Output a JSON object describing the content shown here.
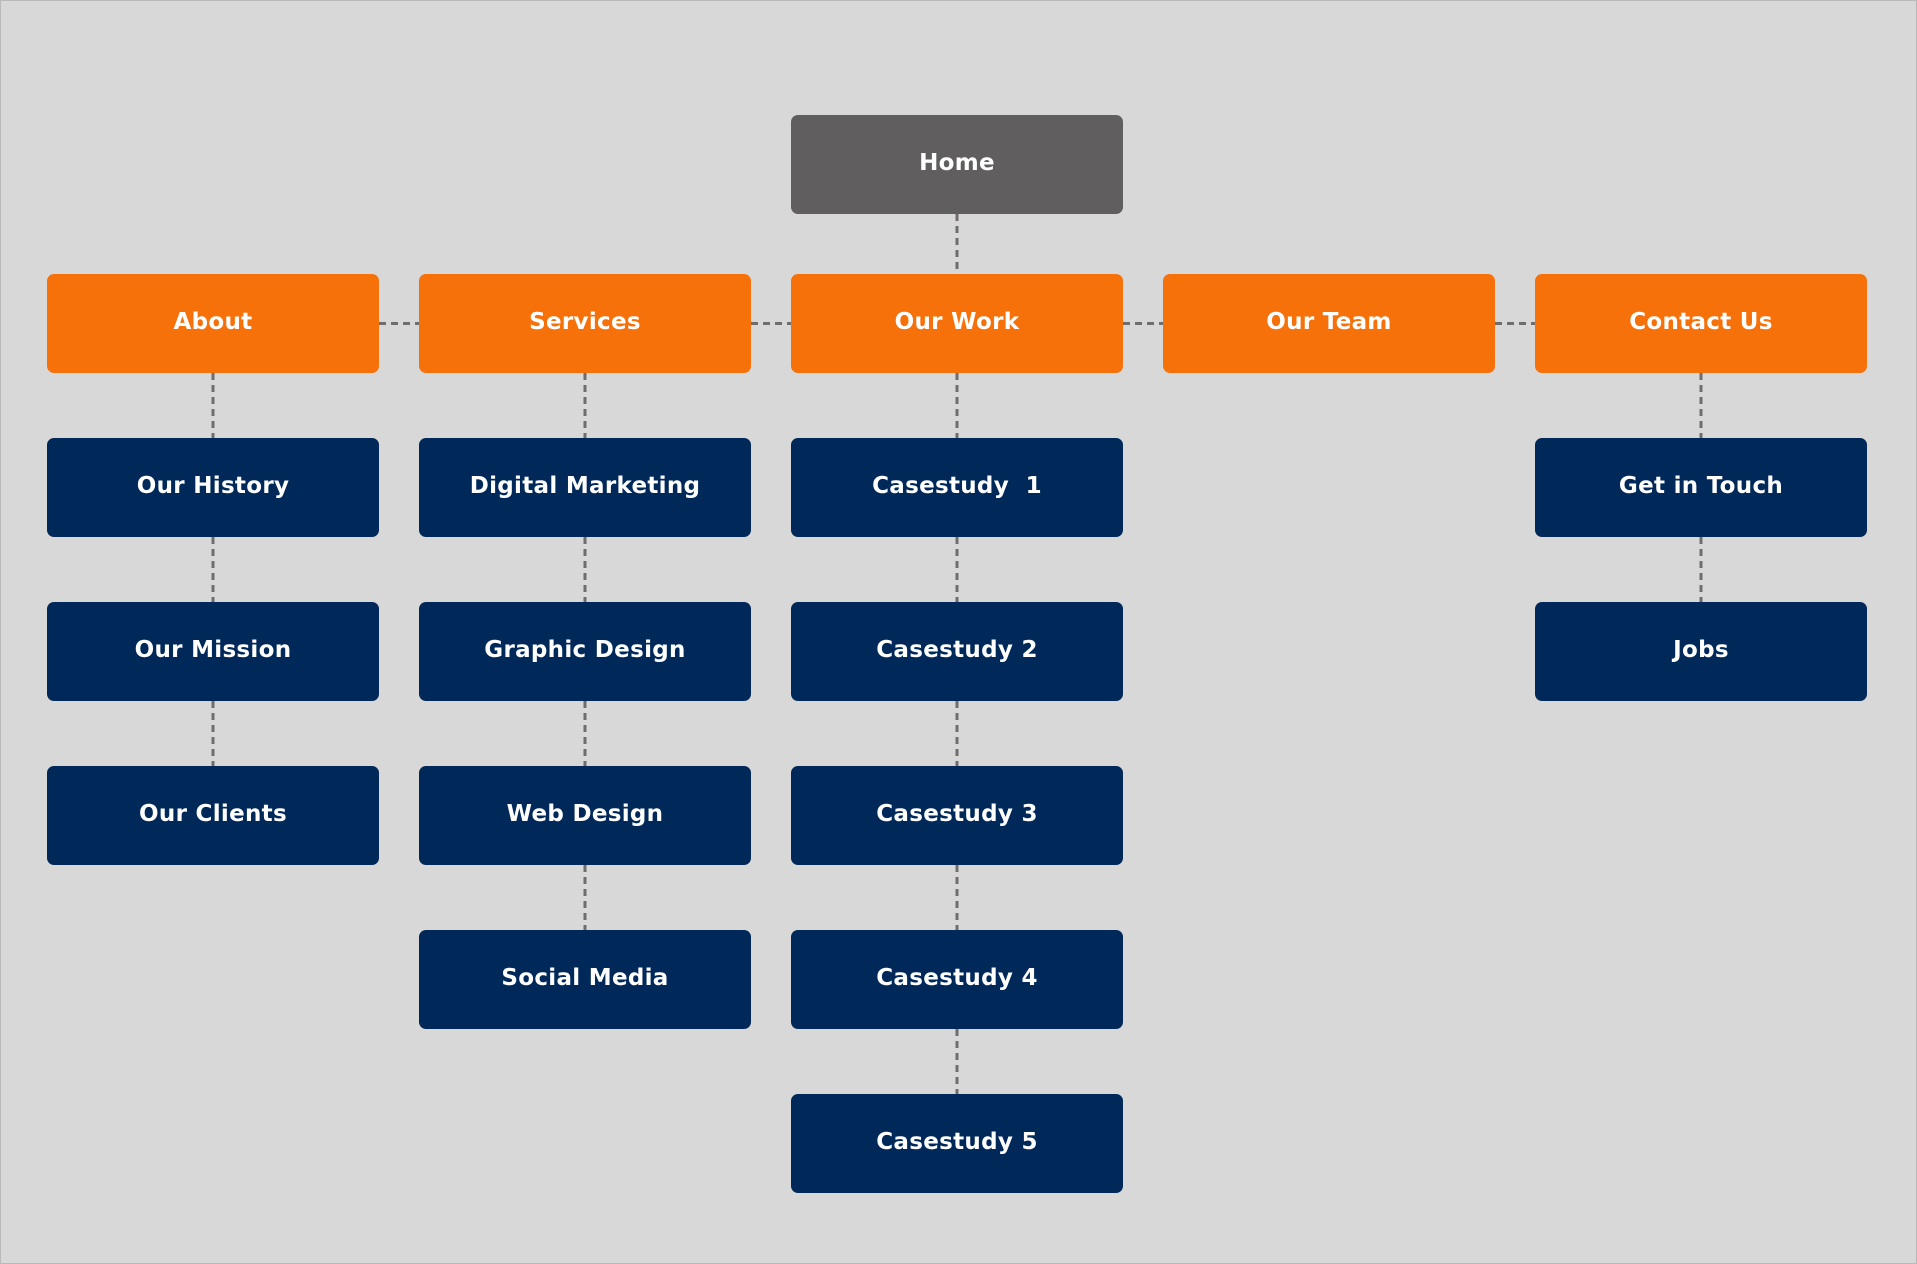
{
  "diagram": {
    "type": "sitemap",
    "colors": {
      "background": "#d8d8d8",
      "root": "#605e5f",
      "primary": "#f7710b",
      "secondary": "#00295a",
      "connector": "#6f6d6f",
      "text": "#ffffff"
    },
    "root": {
      "label": "Home"
    },
    "sections": [
      {
        "label": "About",
        "children": [
          "Our History",
          "Our Mission",
          "Our Clients"
        ]
      },
      {
        "label": "Services",
        "children": [
          "Digital Marketing",
          "Graphic Design",
          "Web Design",
          "Social Media"
        ]
      },
      {
        "label": "Our Work",
        "children": [
          "Casestudy  1",
          "Casestudy 2",
          "Casestudy 3",
          "Casestudy 4",
          "Casestudy 5"
        ]
      },
      {
        "label": "Our Team",
        "children": []
      },
      {
        "label": "Contact Us",
        "children": [
          "Get in Touch",
          "Jobs"
        ]
      }
    ]
  }
}
